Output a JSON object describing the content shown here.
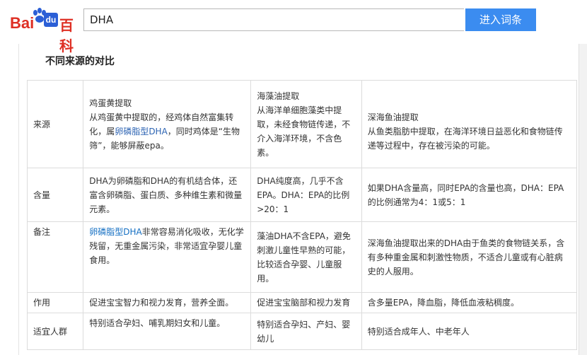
{
  "header": {
    "logo": {
      "baidu": "Bai",
      "du": "du",
      "baike": "百科"
    },
    "search_value": "DHA",
    "search_button": "进入词条"
  },
  "section": {
    "title": "不同来源的对比"
  },
  "table": {
    "rows": [
      {
        "label": "来源",
        "egg": {
          "heading": "鸡蛋黄提取",
          "text_a": "从鸡蛋黄中提取的，经鸡体自然富集转化，属",
          "link": "卵磷脂型DHA",
          "text_b": "，同时鸡体是“生物筛”，能够屏蔽epa。"
        },
        "algae": {
          "heading": "海藻油提取",
          "text": "从海洋单细胞藻类中提取，未经食物链传递，不介入海洋环境，不含色素。"
        },
        "fish": {
          "heading": "深海鱼油提取",
          "text": "从鱼类脂肪中提取，在海洋环境日益恶化和食物链传递等过程中，存在被污染的可能。"
        }
      },
      {
        "label": "含量",
        "egg": {
          "text": "DHA为卵磷脂和DHA的有机结合体，还富含卵磷脂、蛋白质、多种维生素和微量元素。"
        },
        "algae": {
          "text": "DHA纯度高，几乎不含EPA。DHA：EPA的比例>20：1"
        },
        "fish": {
          "text": "如果DHA含量高，同时EPA的含量也高，DHA：EPA的比例通常为4：1或5：1"
        }
      },
      {
        "label": "备注",
        "egg": {
          "link": "卵磷脂型DHA",
          "text_b": "非常容易消化吸收，无化学残留，无重金属污染，非常适宜孕婴儿童食用。"
        },
        "algae": {
          "text": "藻油DHA不含EPA，避免刺激儿童性早熟的可能，比较适合孕婴、儿童服用。"
        },
        "fish": {
          "text": "深海鱼油提取出来的DHA由于鱼类的食物链关系，含有多种重金属和刺激性物质，不适合儿童或有心脏病史的人服用。"
        }
      },
      {
        "label": "作用",
        "egg": {
          "text": "促进宝宝智力和视力发育，营养全面。"
        },
        "algae": {
          "text": "促进宝宝脑部和视力发育"
        },
        "fish": {
          "text": "含多量EPA，降血脂，降低血液粘稠度。"
        }
      },
      {
        "label": "适宜人群",
        "egg": {
          "text": "特别适合孕妇、哺乳期妇女和儿童。"
        },
        "algae": {
          "text": "特别适合孕妇、产妇、婴幼儿"
        },
        "fish": {
          "text": "特别适合成年人、中老年人"
        }
      }
    ]
  },
  "colors": {
    "accent": "#3b8cf0",
    "brand_red": "#de2f24",
    "link": "#2d64b3"
  }
}
